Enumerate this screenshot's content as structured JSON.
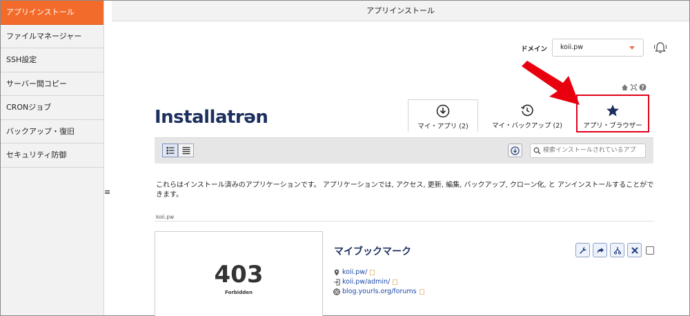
{
  "sidebar": {
    "items": [
      {
        "label": "アプリインストール",
        "active": true
      },
      {
        "label": "ファイルマネージャー",
        "active": false
      },
      {
        "label": "SSH設定",
        "active": false
      },
      {
        "label": "サーバー間コピー",
        "active": false
      },
      {
        "label": "CRONジョブ",
        "active": false
      },
      {
        "label": "バックアップ・復旧",
        "active": false
      },
      {
        "label": "セキュリティ防御",
        "active": false
      }
    ],
    "collapse_glyph": "≡"
  },
  "header": {
    "title": "アプリインストール"
  },
  "domain": {
    "label": "ドメイン",
    "selected": "koii.pw"
  },
  "logo": {
    "text": "Installatrən"
  },
  "tabs": [
    {
      "label": "マイ・アプリ (2)",
      "icon": "download-circle-icon"
    },
    {
      "label": "マイ・バックアップ (2)",
      "icon": "history-clock-icon"
    },
    {
      "label": "アプリ・ブラウザー",
      "icon": "star-icon"
    }
  ],
  "toolbar": {
    "search_placeholder": "検索インストールされているアプ"
  },
  "description": "これらはインストール済みのアプリケーションです。 アプリケーションでは, アクセス, 更新, 編集, バックアップ, クローン化, と アンインストールすることができます。",
  "domain_heading": "koii.pw",
  "app": {
    "thumb_code": "403",
    "thumb_text": "Forbidden",
    "title": "マイブックマーク",
    "links": [
      "koii.pw/",
      "koii.pw/admin/",
      "blog.yourls.org/forums"
    ]
  },
  "colors": {
    "accent": "#f36b2a",
    "highlight": "#e0001b",
    "navy": "#1c2f5e",
    "link": "#1a48a8"
  }
}
